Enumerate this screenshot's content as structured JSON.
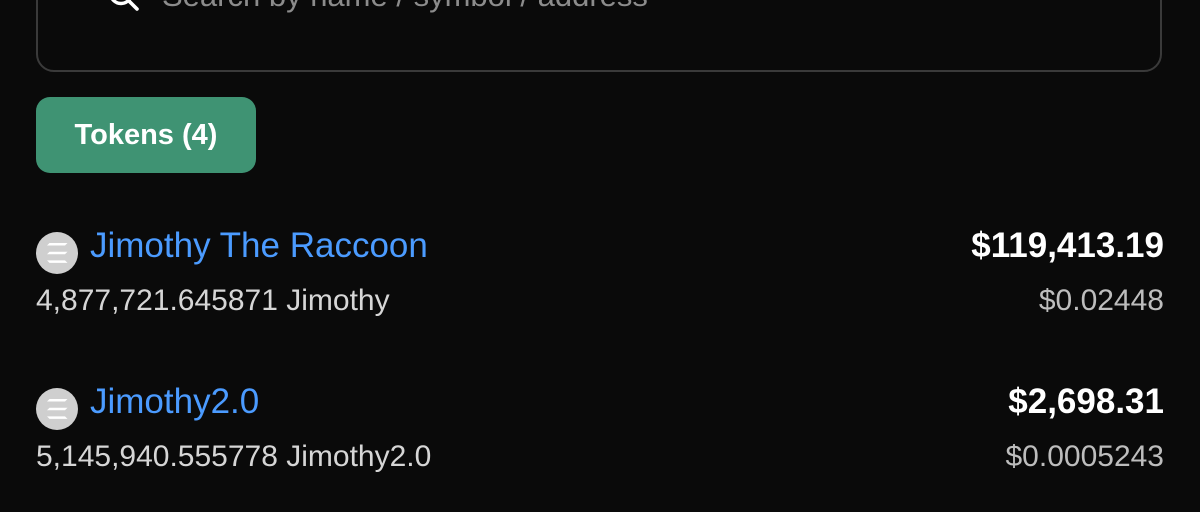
{
  "search": {
    "placeholder": "Search by name / symbol / address",
    "value": ""
  },
  "tabs": [
    {
      "label": "Tokens (4)",
      "active": true,
      "color": "#3f9373"
    }
  ],
  "tokens": [
    {
      "name": "Jimothy The Raccoon",
      "balance": "4,877,721.645871 Jimothy",
      "value": "$119,413.19",
      "price": "$0.02448",
      "icon": "solana-icon"
    },
    {
      "name": "Jimothy2.0",
      "balance": "5,145,940.555778 Jimothy2.0",
      "value": "$2,698.31",
      "price": "$0.0005243",
      "icon": "solana-icon"
    }
  ],
  "colors": {
    "background": "#0a0a0a",
    "link": "#4b9bff",
    "accent": "#3f9373"
  }
}
